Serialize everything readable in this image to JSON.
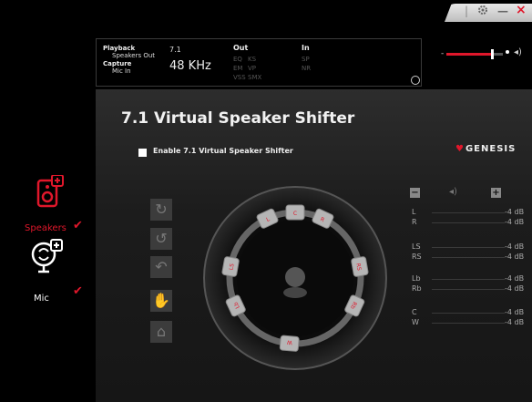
{
  "window": {
    "settings_icon": "gear-icon",
    "minimize_label": "—",
    "close_label": "×"
  },
  "status": {
    "playback_label": "Playback",
    "speakers_out": "Speakers Out",
    "capture_label": "Capture",
    "mic_in": "Mic In",
    "channels": "7.1",
    "frequency": "48 KHz",
    "out_label": "Out",
    "out_items": [
      "EQ",
      "KS",
      "EM",
      "VP",
      "VSS",
      "SMX"
    ],
    "in_label": "In",
    "in_items": [
      "SP",
      "NR"
    ]
  },
  "volume": {
    "level": 0.8,
    "speaker_icon": "speaker-icon"
  },
  "sidebar": {
    "speakers_label": "Speakers",
    "mic_label": "Mic",
    "checkmark": "✔"
  },
  "panel": {
    "title": "7.1 Virtual Speaker Shifter",
    "checkbox_label": "Enable 7.1 Virtual Speaker Shifter",
    "brand": "GENESIS",
    "speaker_tags": [
      "C",
      "L",
      "R",
      "LS",
      "RS",
      "Lb",
      "Rb",
      "W"
    ],
    "levels": [
      {
        "name": "L",
        "db": "-4 dB"
      },
      {
        "name": "R",
        "db": "-4 dB"
      },
      {
        "name": "LS",
        "db": "-4 dB"
      },
      {
        "name": "RS",
        "db": "-4 dB"
      },
      {
        "name": "Lb",
        "db": "-4 dB"
      },
      {
        "name": "Rb",
        "db": "-4 dB"
      },
      {
        "name": "C",
        "db": "-4 dB"
      },
      {
        "name": "W",
        "db": "-4 dB"
      }
    ],
    "minus_label": "−",
    "plus_label": "+"
  },
  "colors": {
    "accent": "#e0172b",
    "panel": "#222222"
  }
}
